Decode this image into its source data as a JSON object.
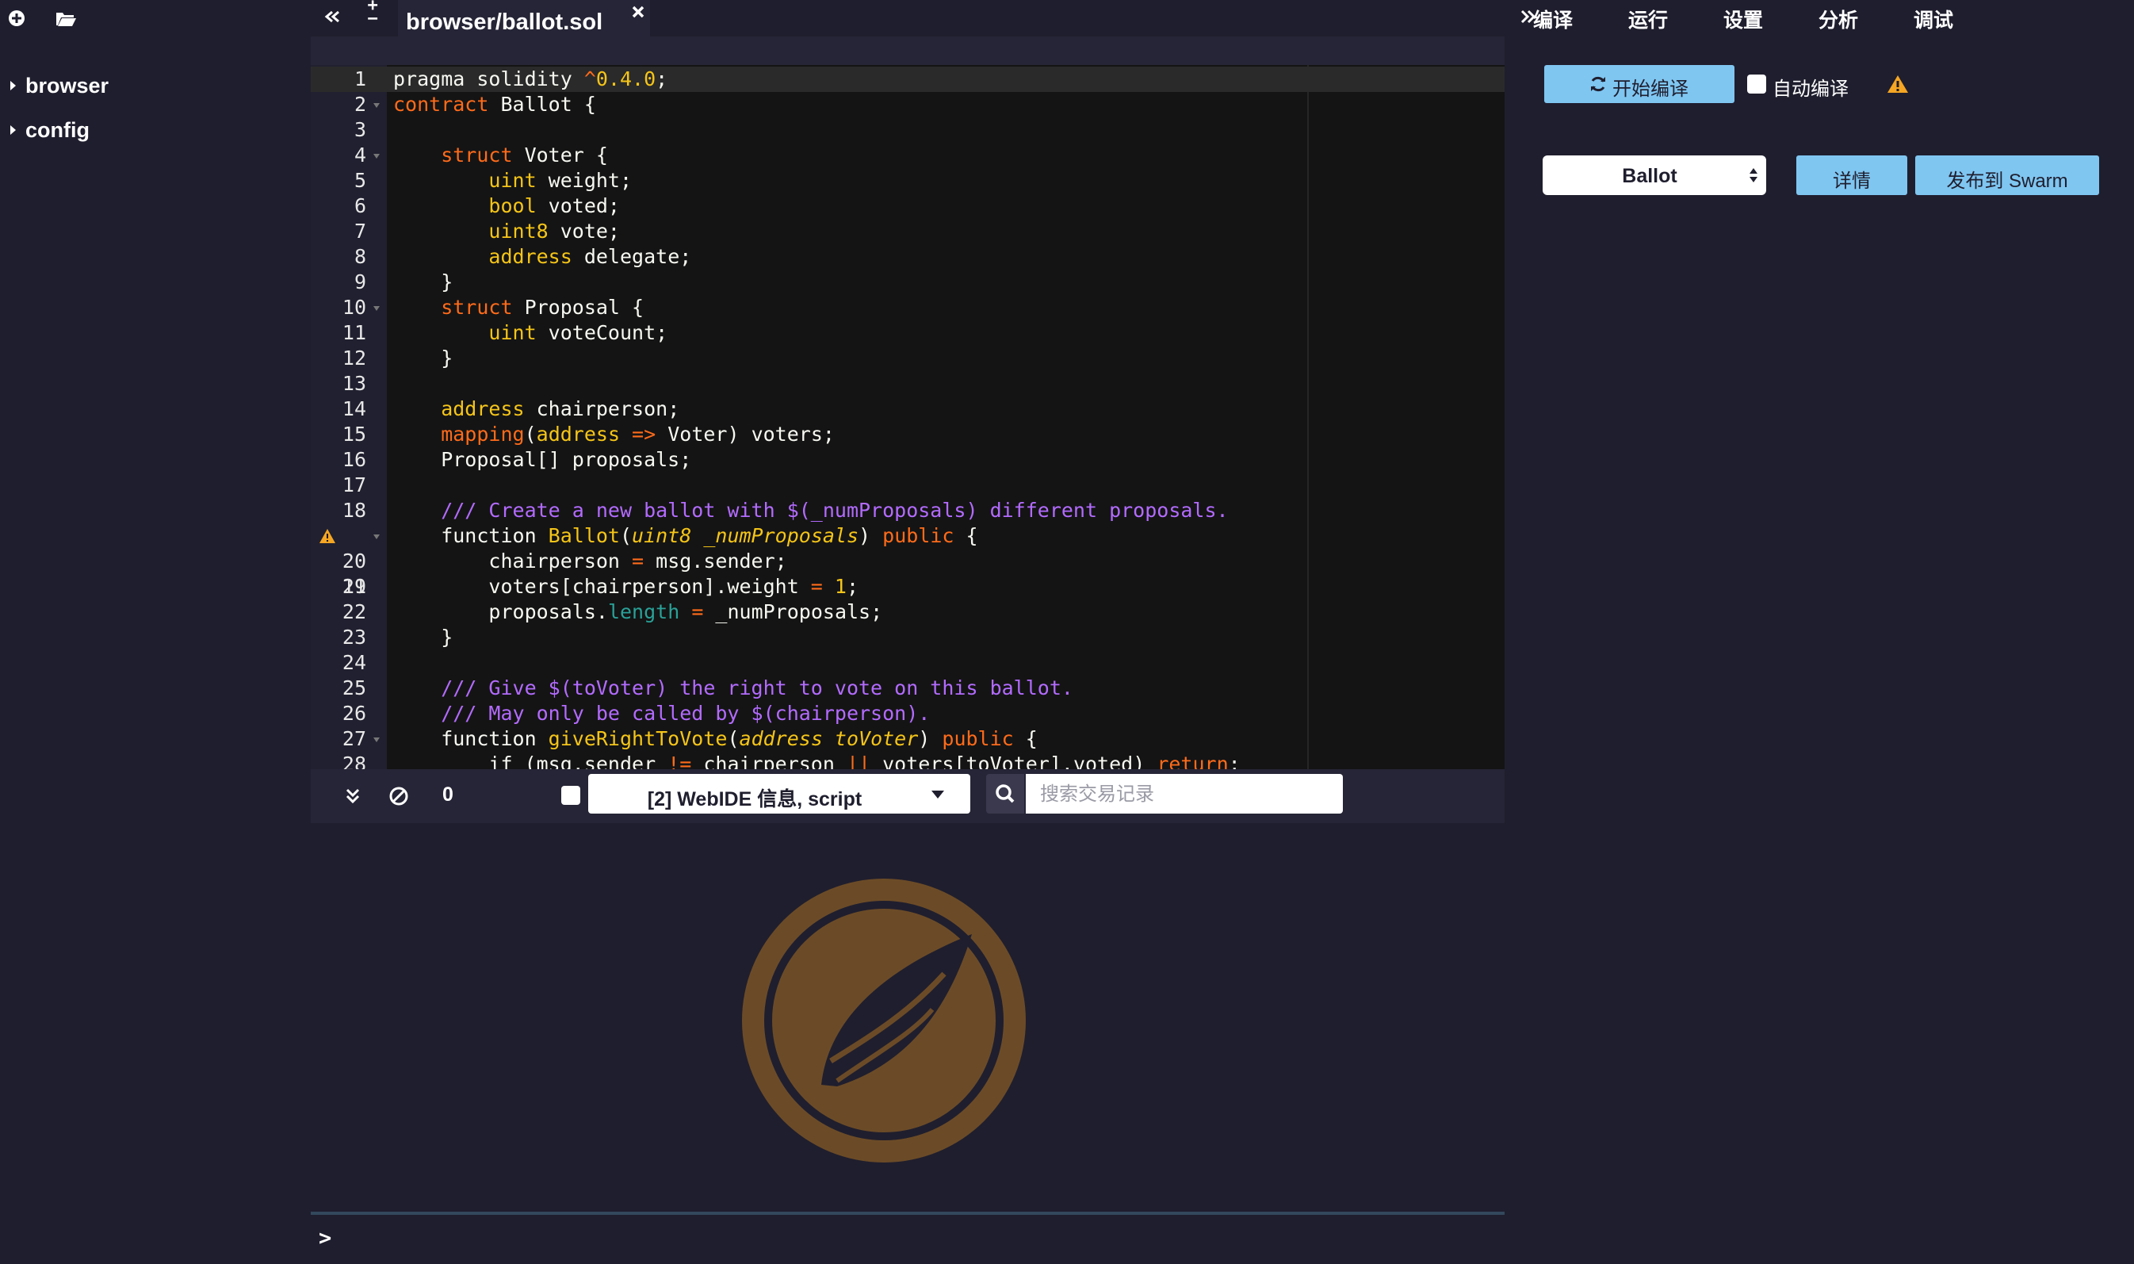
{
  "explorer": {
    "tree": [
      {
        "label": "browser"
      },
      {
        "label": "config"
      }
    ]
  },
  "editor": {
    "tab_title": "browser/ballot.sol",
    "lines": [
      {
        "n": "1"
      },
      {
        "n": "2"
      },
      {
        "n": "3"
      },
      {
        "n": "4"
      },
      {
        "n": "5"
      },
      {
        "n": "6"
      },
      {
        "n": "7"
      },
      {
        "n": "8"
      },
      {
        "n": "9"
      },
      {
        "n": "10"
      },
      {
        "n": "11"
      },
      {
        "n": "12"
      },
      {
        "n": "13"
      },
      {
        "n": "14"
      },
      {
        "n": "15"
      },
      {
        "n": "16"
      },
      {
        "n": "17"
      },
      {
        "n": "18"
      },
      {
        "n": "19"
      },
      {
        "n": "20"
      },
      {
        "n": "21"
      },
      {
        "n": "22"
      },
      {
        "n": "23"
      },
      {
        "n": "24"
      },
      {
        "n": "25"
      },
      {
        "n": "26"
      },
      {
        "n": "27"
      },
      {
        "n": "28"
      }
    ],
    "code": {
      "l1a": "pragma solidity ",
      "l1b": "^",
      "l1c": "0.4.0",
      "l1d": ";",
      "l2a": "contract",
      "l2b": " Ballot {",
      "l4a": "    struct",
      "l4b": " Voter {",
      "l5a": "        uint",
      "l5b": " weight;",
      "l6a": "        bool",
      "l6b": " voted;",
      "l7a": "        uint8",
      "l7b": " vote;",
      "l8a": "        address",
      "l8b": " delegate;",
      "l9": "    }",
      "l10a": "    struct",
      "l10b": " Proposal {",
      "l11a": "        uint",
      "l11b": " voteCount;",
      "l12": "    }",
      "l14a": "    address",
      "l14b": " chairperson;",
      "l15a": "    mapping",
      "l15b": "(",
      "l15c": "address",
      "l15d": " => ",
      "l15e": "Voter) voters;",
      "l16": "    Proposal[] proposals;",
      "l18": "    /// Create a new ballot with $(_numProposals) different proposals.",
      "l19a": "    function ",
      "l19b": "Ballot",
      "l19c": "(",
      "l19d": "uint8 _numProposals",
      "l19e": ") ",
      "l19f": "public",
      "l19g": " {",
      "l20a": "        chairperson ",
      "l20b": "=",
      "l20c": " msg.sender;",
      "l21a": "        voters[chairperson].weight ",
      "l21b": "=",
      "l21c": " ",
      "l21d": "1",
      "l21e": ";",
      "l22a": "        proposals.",
      "l22b": "length",
      "l22c": " ",
      "l22d": "=",
      "l22e": " _numProposals;",
      "l23": "    }",
      "l25": "    /// Give $(toVoter) the right to vote on this ballot.",
      "l26": "    /// May only be called by $(chairperson).",
      "l27a": "    function ",
      "l27b": "giveRightToVote",
      "l27c": "(",
      "l27d": "address toVoter",
      "l27e": ") ",
      "l27f": "public",
      "l27g": " {",
      "l28a": "        if (msg.sender ",
      "l28b": "!=",
      "l28c": " chairperson ",
      "l28d": "||",
      "l28e": " voters[toVoter].voted) ",
      "l28f": "return",
      "l28g": ";"
    }
  },
  "terminal": {
    "pending_count": "0",
    "filter_label": "[2] WebIDE 信息, script",
    "search_placeholder": "搜索交易记录",
    "prompt": ">"
  },
  "right_panel": {
    "tabs": [
      "编译",
      "运行",
      "设置",
      "分析",
      "调试"
    ],
    "compile_label": "开始编译",
    "auto_compile_label": "自动编译",
    "contract_selected": "Ballot",
    "details_label": "详情",
    "swarm_label": "发布到 Swarm"
  },
  "colors": {
    "background": "#1f1e2e",
    "editor_bg": "#141414",
    "accent_button": "#7fc6f1",
    "keyword": "#f5a623",
    "comment": "#b36bff",
    "warning": "#f5a623",
    "logo": "#6b4b27"
  },
  "icons": [
    "add-file-icon",
    "open-folder-icon",
    "collapse-left-icon",
    "zoom-icon",
    "close-icon",
    "expand-right-icon",
    "caret-right-icon",
    "fold-icon",
    "warning-icon",
    "chevron-double-down-icon",
    "clear-icon",
    "search-icon",
    "refresh-icon",
    "logo-leaf-icon"
  ]
}
